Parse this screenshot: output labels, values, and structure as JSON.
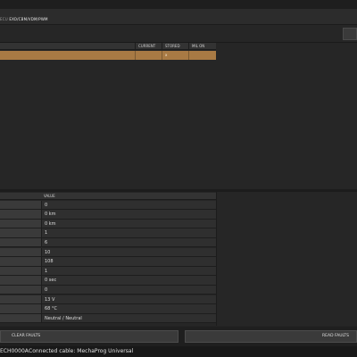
{
  "header": {
    "path_prefix": "ECU",
    "path": "EXO/CBM/VDM/PWM"
  },
  "faults": {
    "columns": [
      "CURRENT",
      "STORED",
      "MIL ON"
    ],
    "rows": [
      {
        "current": "",
        "stored": "x",
        "mil_on": ""
      }
    ]
  },
  "values": {
    "column_header": "VALUE",
    "rows": [
      {
        "value": "0"
      },
      {
        "value": "0 km"
      },
      {
        "value": "0 km"
      },
      {
        "value": "1"
      },
      {
        "value": "6"
      },
      {
        "value": "10"
      },
      {
        "value": "108"
      },
      {
        "value": "1"
      },
      {
        "value": "0 sec"
      },
      {
        "value": "0"
      },
      {
        "value": "13 V"
      },
      {
        "value": "68 °C"
      },
      {
        "value": "Neutral / Neutral"
      }
    ]
  },
  "buttons": {
    "clear_faults": "CLEAR FAULTS",
    "read_faults": "READ FAULTS"
  },
  "status": {
    "code": "ECH0000A",
    "cable": "Connected cable: MechaProg Universal"
  },
  "colors": {
    "fault_row": "#a87a44",
    "background": "#242424"
  }
}
